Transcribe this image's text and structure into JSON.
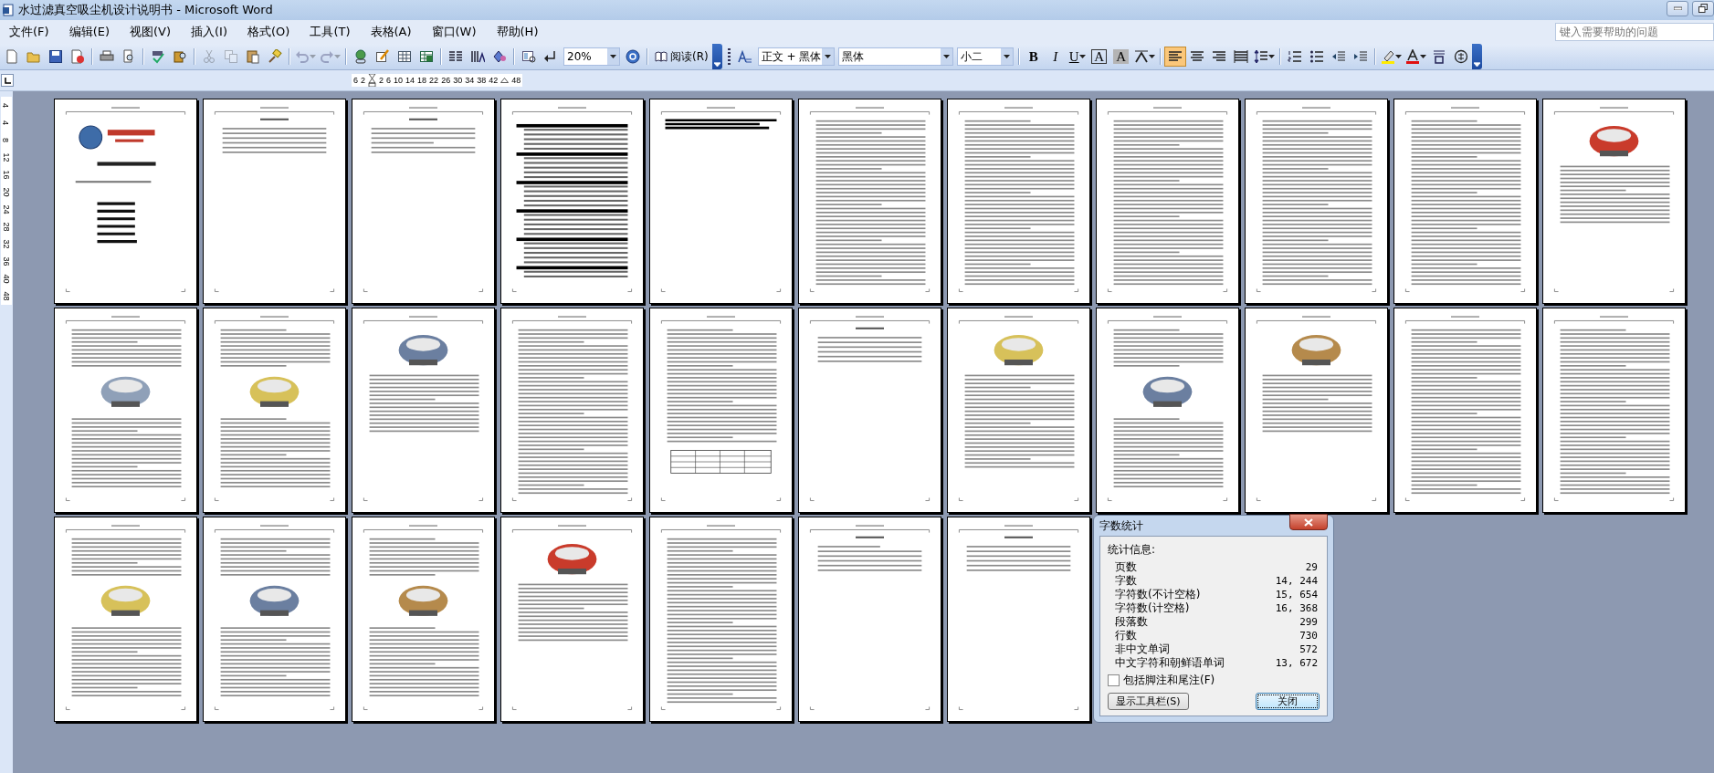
{
  "window": {
    "title": "水过滤真空吸尘机设计说明书 - Microsoft Word"
  },
  "menu": [
    "文件(F)",
    "编辑(E)",
    "视图(V)",
    "插入(I)",
    "格式(O)",
    "工具(T)",
    "表格(A)",
    "窗口(W)",
    "帮助(H)"
  ],
  "help_box": {
    "placeholder": "键入需要帮助的问题"
  },
  "toolbar": [
    {
      "kind": "icon",
      "disabled": false,
      "on": false
    },
    {
      "kind": "icon",
      "disabled": false,
      "on": false
    },
    {
      "kind": "icon",
      "disabled": false,
      "on": false
    },
    {
      "kind": "icon",
      "disabled": false,
      "on": false
    },
    {
      "kind": "sep"
    },
    {
      "kind": "icon",
      "disabled": false,
      "on": false
    },
    {
      "kind": "icon",
      "disabled": false,
      "on": false
    },
    {
      "kind": "sep"
    },
    {
      "kind": "icon",
      "disabled": false,
      "on": false
    },
    {
      "kind": "icon",
      "disabled": false,
      "on": false
    },
    {
      "kind": "sep"
    },
    {
      "kind": "icon",
      "disabled": true,
      "on": false
    },
    {
      "kind": "icon",
      "disabled": true,
      "on": false
    },
    {
      "kind": "icon",
      "disabled": false,
      "on": false
    },
    {
      "kind": "icon",
      "disabled": false,
      "on": false
    },
    {
      "kind": "sep"
    },
    {
      "kind": "split_icon",
      "disabled": true,
      "on": false
    },
    {
      "kind": "split_icon",
      "disabled": true,
      "on": false
    },
    {
      "kind": "sep"
    },
    {
      "kind": "icon",
      "disabled": false,
      "on": false
    },
    {
      "kind": "icon",
      "disabled": false,
      "on": false
    },
    {
      "kind": "icon",
      "disabled": false,
      "on": false
    },
    {
      "kind": "icon",
      "disabled": false,
      "on": false
    },
    {
      "kind": "sep"
    },
    {
      "kind": "icon",
      "disabled": false,
      "on": false
    },
    {
      "kind": "icon",
      "disabled": false,
      "on": false
    },
    {
      "kind": "icon",
      "disabled": false,
      "on": false
    },
    {
      "kind": "sep"
    },
    {
      "kind": "icon",
      "disabled": false,
      "on": false
    },
    {
      "kind": "icon",
      "disabled": false,
      "on": false
    },
    {
      "kind": "combo",
      "value": "20%"
    },
    {
      "kind": "icon",
      "disabled": false,
      "on": false
    },
    {
      "kind": "sep"
    },
    {
      "kind": "button",
      "label": "阅读(R)"
    },
    {
      "kind": "end"
    },
    {
      "kind": "grip"
    },
    {
      "kind": "icon",
      "disabled": false,
      "on": false
    },
    {
      "kind": "combo",
      "value": "正文 + 黑体"
    },
    {
      "kind": "combo",
      "value": "黑体"
    },
    {
      "kind": "combo",
      "value": "小二"
    },
    {
      "kind": "sep"
    },
    {
      "kind": "glyph",
      "text": "B",
      "disabled": false,
      "on": false
    },
    {
      "kind": "glyph",
      "text": "I",
      "disabled": false,
      "on": false
    },
    {
      "kind": "split_glyph",
      "text": "U",
      "disabled": false,
      "on": false
    },
    {
      "kind": "glyph",
      "text": "A",
      "disabled": false,
      "on": false
    },
    {
      "kind": "glyph",
      "text": "A",
      "disabled": false,
      "on": false
    },
    {
      "kind": "split_icon",
      "disabled": false,
      "on": false
    },
    {
      "kind": "sep"
    },
    {
      "kind": "icon",
      "disabled": false,
      "on": true
    },
    {
      "kind": "icon",
      "disabled": false,
      "on": false
    },
    {
      "kind": "icon",
      "disabled": false,
      "on": false
    },
    {
      "kind": "icon",
      "disabled": false,
      "on": false
    },
    {
      "kind": "split_icon",
      "disabled": false,
      "on": false
    },
    {
      "kind": "sep"
    },
    {
      "kind": "icon",
      "disabled": false,
      "on": false
    },
    {
      "kind": "icon",
      "disabled": false,
      "on": false
    },
    {
      "kind": "icon",
      "disabled": false,
      "on": false
    },
    {
      "kind": "icon",
      "disabled": false,
      "on": false
    },
    {
      "kind": "sep"
    },
    {
      "kind": "split_icon",
      "disabled": false,
      "on": false
    },
    {
      "kind": "split_icon",
      "disabled": false,
      "on": false
    },
    {
      "kind": "icon",
      "disabled": false,
      "on": false
    },
    {
      "kind": "icon",
      "disabled": false,
      "on": false
    },
    {
      "kind": "end"
    }
  ],
  "ruler": {
    "numbers": [
      "6",
      "2",
      "2",
      "6",
      "10",
      "14",
      "18",
      "22",
      "26",
      "30",
      "34",
      "38",
      "42",
      "48"
    ]
  },
  "vertical_ruler": {
    "numbers": [
      "4",
      "4",
      "8",
      "12",
      "16",
      "20",
      "24",
      "28",
      "32",
      "36",
      "40",
      "48"
    ]
  },
  "pages": [
    {
      "kind": "cover"
    },
    {
      "kind": "short"
    },
    {
      "kind": "short"
    },
    {
      "kind": "toc"
    },
    {
      "kind": "toc_end"
    },
    {
      "kind": "text"
    },
    {
      "kind": "text"
    },
    {
      "kind": "text"
    },
    {
      "kind": "text"
    },
    {
      "kind": "text"
    },
    {
      "kind": "figure_top"
    },
    {
      "kind": "figure"
    },
    {
      "kind": "figure"
    },
    {
      "kind": "figure_top"
    },
    {
      "kind": "text"
    },
    {
      "kind": "table"
    },
    {
      "kind": "short"
    },
    {
      "kind": "figure_top"
    },
    {
      "kind": "figure"
    },
    {
      "kind": "figure_top"
    },
    {
      "kind": "text"
    },
    {
      "kind": "text"
    },
    {
      "kind": "figure"
    },
    {
      "kind": "figure"
    },
    {
      "kind": "figure"
    },
    {
      "kind": "figure_top"
    },
    {
      "kind": "text"
    },
    {
      "kind": "short"
    },
    {
      "kind": "short"
    }
  ],
  "word_count_dialog": {
    "title": "字数统计",
    "section": "统计信息:",
    "rows": [
      {
        "label": "页数",
        "value": "29"
      },
      {
        "label": "字数",
        "value": "14, 244"
      },
      {
        "label": "字符数(不计空格)",
        "value": "15, 654"
      },
      {
        "label": "字符数(计空格)",
        "value": "16, 368"
      },
      {
        "label": "段落数",
        "value": "299"
      },
      {
        "label": "行数",
        "value": "730"
      },
      {
        "label": "非中文单词",
        "value": "572"
      },
      {
        "label": "中文字符和朝鲜语单词",
        "value": "13, 672"
      }
    ],
    "checkbox": {
      "label": "包括脚注和尾注(F)",
      "checked": false
    },
    "buttons": [
      {
        "label": "显示工具栏(S)",
        "default": false
      },
      {
        "label": "关闭",
        "default": true
      }
    ]
  }
}
